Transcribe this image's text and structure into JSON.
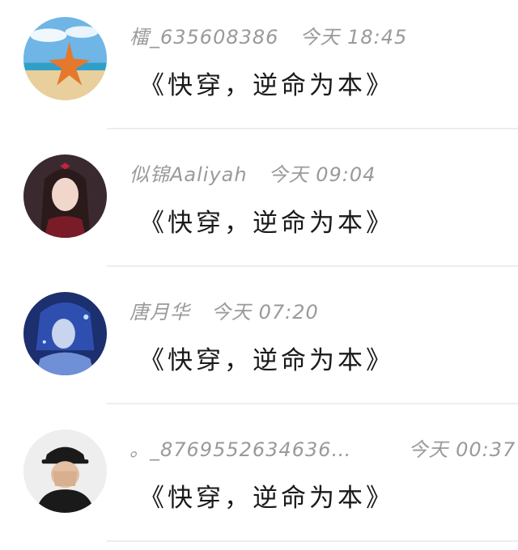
{
  "comments": [
    {
      "name": "檑_635608386",
      "time": "今天 18:45",
      "message": "《快穿，逆命为本》",
      "avatar": "starfish-beach-avatar"
    },
    {
      "name": "似锦Aaliyah",
      "time": "今天 09:04",
      "message": "《快穿，逆命为本》",
      "avatar": "anime-girl-avatar"
    },
    {
      "name": "唐月华",
      "time": "今天 07:20",
      "message": "《快穿，逆命为本》",
      "avatar": "blue-fantasy-avatar"
    },
    {
      "name": "。_8769552634636…",
      "time": "今天 00:37",
      "message": "《快穿，逆命为本》",
      "avatar": "cap-man-avatar"
    }
  ],
  "colors": {
    "name_time": "#9a9a9a",
    "message": "#1a1a1a",
    "divider": "#ededed"
  }
}
